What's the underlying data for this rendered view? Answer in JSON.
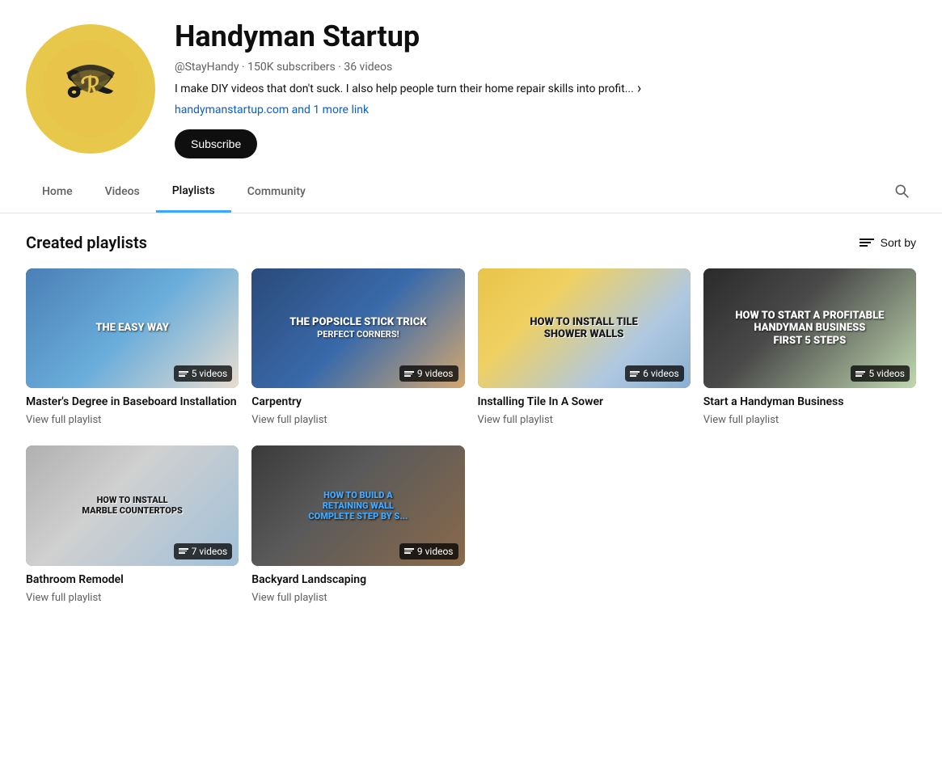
{
  "channel": {
    "name": "Handyman Startup",
    "handle": "@StayHandy",
    "subscribers": "150K subscribers",
    "video_count": "36 videos",
    "description": "I make DIY videos that don't suck. I also help people turn their home repair skills into profit...",
    "links": "handymanstartup.com and 1 more link",
    "subscribe_label": "Subscribe"
  },
  "nav": {
    "tabs": [
      {
        "label": "Home",
        "active": false
      },
      {
        "label": "Videos",
        "active": false
      },
      {
        "label": "Playlists",
        "active": true
      },
      {
        "label": "Community",
        "active": false
      }
    ],
    "search_title": "Search"
  },
  "section": {
    "title": "Created playlists",
    "sort_label": "Sort by"
  },
  "playlists": [
    {
      "id": "1",
      "title": "Master's Degree in Baseboard Installation",
      "video_count": "5 videos",
      "link_label": "View full playlist",
      "thumb_class": "thumb-baseboard",
      "thumb_text": "THE EASY WAY"
    },
    {
      "id": "2",
      "title": "Carpentry",
      "video_count": "9 videos",
      "link_label": "View full playlist",
      "thumb_class": "thumb-carpentry",
      "thumb_text": "THE POPSICLE STICK TRICK Perfect corners!"
    },
    {
      "id": "3",
      "title": "Installing Tile In A Sower",
      "video_count": "6 videos",
      "link_label": "View full playlist",
      "thumb_class": "thumb-tile",
      "thumb_text": "HOW TO INSTALL TILE Shower Walls"
    },
    {
      "id": "4",
      "title": "Start a Handyman Business",
      "video_count": "5 videos",
      "link_label": "View full playlist",
      "thumb_class": "thumb-handyman",
      "thumb_text": "How to Start a Profitable Handyman Business First 5 Steps"
    },
    {
      "id": "5",
      "title": "Bathroom Remodel",
      "video_count": "7 videos",
      "link_label": "View full playlist",
      "thumb_class": "thumb-marble",
      "thumb_text": "HOW TO INSTALL MARBLE COUNTERTOPS"
    },
    {
      "id": "6",
      "title": "Backyard Landscaping",
      "video_count": "9 videos",
      "link_label": "View full playlist",
      "thumb_class": "thumb-retaining",
      "thumb_text": "How to Build a Retaining Wall Complete Step By S..."
    }
  ]
}
